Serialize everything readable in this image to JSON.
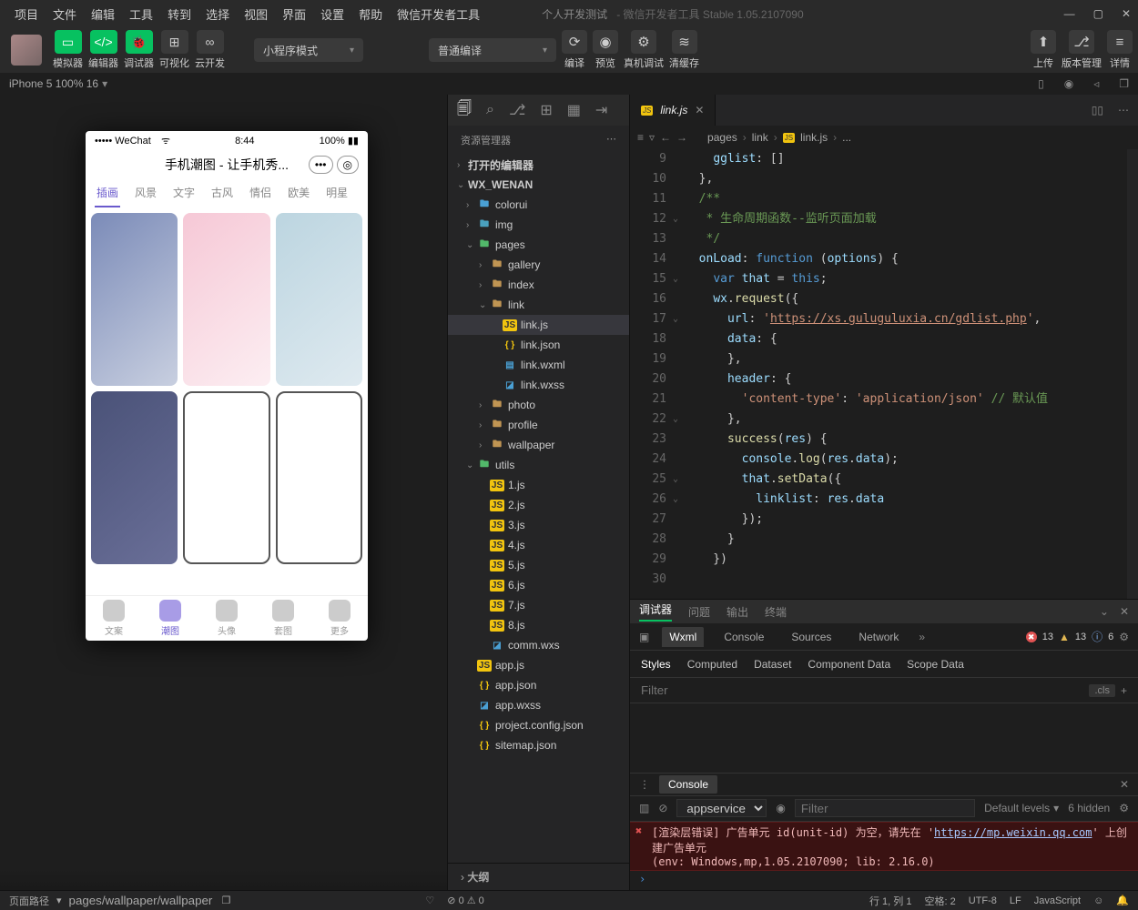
{
  "menubar": {
    "items": [
      "项目",
      "文件",
      "编辑",
      "工具",
      "转到",
      "选择",
      "视图",
      "界面",
      "设置",
      "帮助",
      "微信开发者工具"
    ],
    "title": "个人开发测试",
    "subtitle": "- 微信开发者工具 Stable 1.05.2107090"
  },
  "toolbar": {
    "modes": [
      "模拟器",
      "编辑器",
      "调试器"
    ],
    "view_btns": [
      "可视化",
      "云开发"
    ],
    "compile_mode_label": "小程序模式",
    "compile_type_label": "普通编译",
    "center_btns": [
      "编译",
      "预览",
      "真机调试",
      "清缓存"
    ],
    "right_btns": [
      "上传",
      "版本管理",
      "详情"
    ]
  },
  "sim_status": "iPhone 5 100% 16",
  "phone": {
    "status_left": "••••• WeChat",
    "time": "8:44",
    "battery": "100%",
    "title": "手机潮图 - 让手机秀...",
    "tabs": [
      "插画",
      "风景",
      "文字",
      "古风",
      "情侣",
      "欧美",
      "明星"
    ],
    "nav": [
      "文案",
      "潮图",
      "头像",
      "套图",
      "更多"
    ]
  },
  "explorer": {
    "title": "资源管理器",
    "open_editors": "打开的编辑器",
    "root": "WX_WENAN",
    "tree": [
      {
        "ind": 1,
        "type": "folder",
        "icon": "blue",
        "name": "colorui"
      },
      {
        "ind": 1,
        "type": "folder",
        "icon": "img",
        "name": "img"
      },
      {
        "ind": 1,
        "type": "folder",
        "icon": "green",
        "open": true,
        "name": "pages"
      },
      {
        "ind": 2,
        "type": "folder",
        "name": "gallery"
      },
      {
        "ind": 2,
        "type": "folder",
        "name": "index"
      },
      {
        "ind": 2,
        "type": "folder",
        "open": true,
        "name": "link"
      },
      {
        "ind": 3,
        "type": "js",
        "name": "link.js",
        "sel": true
      },
      {
        "ind": 3,
        "type": "json",
        "name": "link.json"
      },
      {
        "ind": 3,
        "type": "wxml",
        "name": "link.wxml"
      },
      {
        "ind": 3,
        "type": "wxss",
        "name": "link.wxss"
      },
      {
        "ind": 2,
        "type": "folder",
        "name": "photo"
      },
      {
        "ind": 2,
        "type": "folder",
        "name": "profile"
      },
      {
        "ind": 2,
        "type": "folder",
        "name": "wallpaper"
      },
      {
        "ind": 1,
        "type": "folder",
        "icon": "green",
        "open": true,
        "name": "utils"
      },
      {
        "ind": 2,
        "type": "js",
        "name": "1.js"
      },
      {
        "ind": 2,
        "type": "js",
        "name": "2.js"
      },
      {
        "ind": 2,
        "type": "js",
        "name": "3.js"
      },
      {
        "ind": 2,
        "type": "js",
        "name": "4.js"
      },
      {
        "ind": 2,
        "type": "js",
        "name": "5.js"
      },
      {
        "ind": 2,
        "type": "js",
        "name": "6.js"
      },
      {
        "ind": 2,
        "type": "js",
        "name": "7.js"
      },
      {
        "ind": 2,
        "type": "js",
        "name": "8.js"
      },
      {
        "ind": 2,
        "type": "wxss",
        "name": "comm.wxs"
      },
      {
        "ind": 1,
        "type": "js",
        "name": "app.js"
      },
      {
        "ind": 1,
        "type": "json",
        "name": "app.json"
      },
      {
        "ind": 1,
        "type": "wxss",
        "name": "app.wxss"
      },
      {
        "ind": 1,
        "type": "json",
        "name": "project.config.json"
      },
      {
        "ind": 1,
        "type": "json",
        "name": "sitemap.json"
      }
    ],
    "outline": "大纲"
  },
  "editor": {
    "tab": "link.js",
    "breadcrumb": [
      "pages",
      "link",
      "link.js",
      "..."
    ],
    "first_line_no": 9,
    "fold_marks": {
      "12": "v",
      "15": "v",
      "17": "v",
      "22": "v",
      "25": "v",
      "26": "v"
    }
  },
  "debugger": {
    "tabs1": [
      "调试器",
      "问题",
      "输出",
      "终端"
    ],
    "tabs2": [
      "Wxml",
      "Console",
      "Sources",
      "Network"
    ],
    "err": "13",
    "warn": "13",
    "info": "6",
    "styles_tabs": [
      "Styles",
      "Computed",
      "Dataset",
      "Component Data",
      "Scope Data"
    ],
    "filter_placeholder": "Filter",
    "cls_label": ".cls",
    "console_tab": "Console",
    "console_context": "appservice",
    "console_filter_placeholder": "Filter",
    "levels": "Default levels",
    "hidden": "6 hidden",
    "err_text_1": "[渲染层错误] 广告单元 id(unit-id) 为空，请先在 '",
    "err_link": "https://mp.weixin.qq.com",
    "err_text_2": "' 上创建广告单元",
    "err_env": "(env: Windows,mp,1.05.2107090; lib: 2.16.0)"
  },
  "status": {
    "path_label": "页面路径",
    "path": "pages/wallpaper/wallpaper",
    "counters": "0 ⚠ 0",
    "pos": "行 1, 列 1",
    "spaces": "空格: 2",
    "enc": "UTF-8",
    "eol": "LF",
    "lang": "JavaScript"
  }
}
